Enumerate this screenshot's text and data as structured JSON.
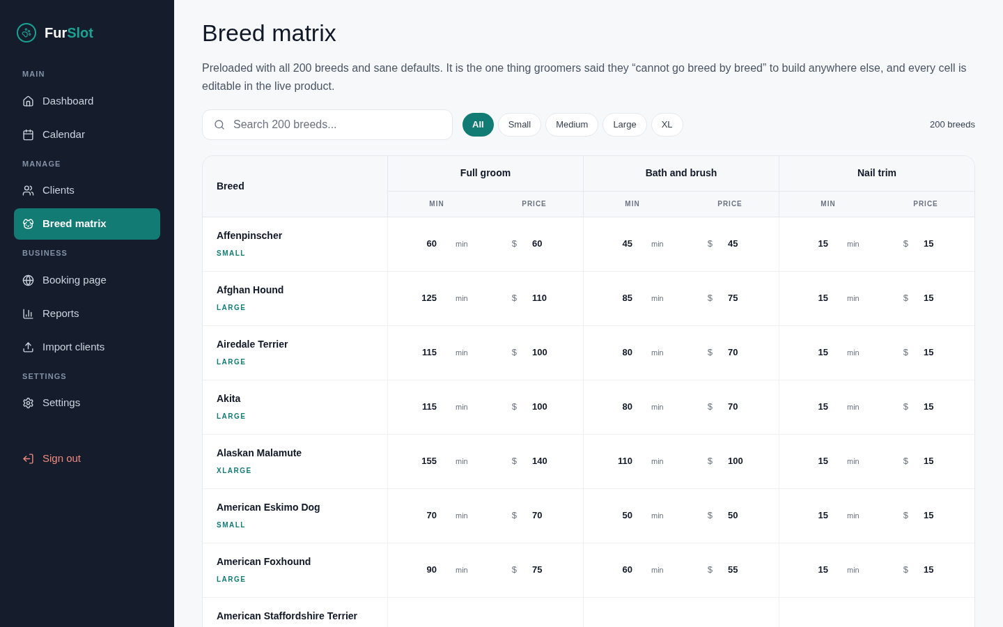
{
  "brand": {
    "first": "Fur",
    "second": "Slot"
  },
  "nav": [
    {
      "section": "MAIN",
      "items": [
        {
          "label": "Dashboard",
          "selected": false
        },
        {
          "label": "Calendar",
          "selected": false
        }
      ]
    },
    {
      "section": "MANAGE",
      "items": [
        {
          "label": "Clients",
          "selected": false
        },
        {
          "label": "Breed matrix",
          "selected": true
        }
      ]
    },
    {
      "section": "BUSINESS",
      "items": [
        {
          "label": "Booking page",
          "selected": false
        },
        {
          "label": "Reports",
          "selected": false
        },
        {
          "label": "Import clients",
          "selected": false
        }
      ]
    },
    {
      "section": "SETTINGS",
      "items": [
        {
          "label": "Settings",
          "selected": false
        }
      ]
    }
  ],
  "sign_out": "Sign out",
  "title": "Breed matrix",
  "description": "Preloaded with all 200 breeds and sane defaults. It is the one thing groomers said they “cannot go breed by breed” to build anywhere else, and every cell is editable in the live product.",
  "search": {
    "placeholder": "Search 200 breeds..."
  },
  "filters": [
    {
      "label": "All",
      "selected": true
    },
    {
      "label": "Small",
      "selected": false
    },
    {
      "label": "Medium",
      "selected": false
    },
    {
      "label": "Large",
      "selected": false
    },
    {
      "label": "XL",
      "selected": false
    }
  ],
  "count": "200 breeds",
  "table": {
    "breed_header": "Breed",
    "services": [
      {
        "name": "Full groom",
        "sub": [
          "MIN",
          "PRICE"
        ]
      },
      {
        "name": "Bath and brush",
        "sub": [
          "MIN",
          "PRICE"
        ]
      },
      {
        "name": "Nail trim",
        "sub": [
          "MIN",
          "PRICE"
        ]
      }
    ],
    "rows": [
      {
        "breed": "Affenpinscher",
        "size": "SMALL",
        "cells": [
          {
            "min": "60",
            "unit": "min",
            "currency": "$",
            "price": "60"
          },
          {
            "min": "45",
            "unit": "min",
            "currency": "$",
            "price": "45"
          },
          {
            "min": "15",
            "unit": "min",
            "currency": "$",
            "price": "15"
          }
        ]
      },
      {
        "breed": "Afghan Hound",
        "size": "LARGE",
        "cells": [
          {
            "min": "125",
            "unit": "min",
            "currency": "$",
            "price": "110"
          },
          {
            "min": "85",
            "unit": "min",
            "currency": "$",
            "price": "75"
          },
          {
            "min": "15",
            "unit": "min",
            "currency": "$",
            "price": "15"
          }
        ]
      },
      {
        "breed": "Airedale Terrier",
        "size": "LARGE",
        "cells": [
          {
            "min": "115",
            "unit": "min",
            "currency": "$",
            "price": "100"
          },
          {
            "min": "80",
            "unit": "min",
            "currency": "$",
            "price": "70"
          },
          {
            "min": "15",
            "unit": "min",
            "currency": "$",
            "price": "15"
          }
        ]
      },
      {
        "breed": "Akita",
        "size": "LARGE",
        "cells": [
          {
            "min": "115",
            "unit": "min",
            "currency": "$",
            "price": "100"
          },
          {
            "min": "80",
            "unit": "min",
            "currency": "$",
            "price": "70"
          },
          {
            "min": "15",
            "unit": "min",
            "currency": "$",
            "price": "15"
          }
        ]
      },
      {
        "breed": "Alaskan Malamute",
        "size": "XLARGE",
        "cells": [
          {
            "min": "155",
            "unit": "min",
            "currency": "$",
            "price": "140"
          },
          {
            "min": "110",
            "unit": "min",
            "currency": "$",
            "price": "100"
          },
          {
            "min": "15",
            "unit": "min",
            "currency": "$",
            "price": "15"
          }
        ]
      },
      {
        "breed": "American Eskimo Dog",
        "size": "SMALL",
        "cells": [
          {
            "min": "70",
            "unit": "min",
            "currency": "$",
            "price": "70"
          },
          {
            "min": "50",
            "unit": "min",
            "currency": "$",
            "price": "50"
          },
          {
            "min": "15",
            "unit": "min",
            "currency": "$",
            "price": "15"
          }
        ]
      },
      {
        "breed": "American Foxhound",
        "size": "LARGE",
        "cells": [
          {
            "min": "90",
            "unit": "min",
            "currency": "$",
            "price": "75"
          },
          {
            "min": "60",
            "unit": "min",
            "currency": "$",
            "price": "55"
          },
          {
            "min": "15",
            "unit": "min",
            "currency": "$",
            "price": "15"
          }
        ]
      },
      {
        "breed": "American Staffordshire Terrier"
      }
    ]
  }
}
